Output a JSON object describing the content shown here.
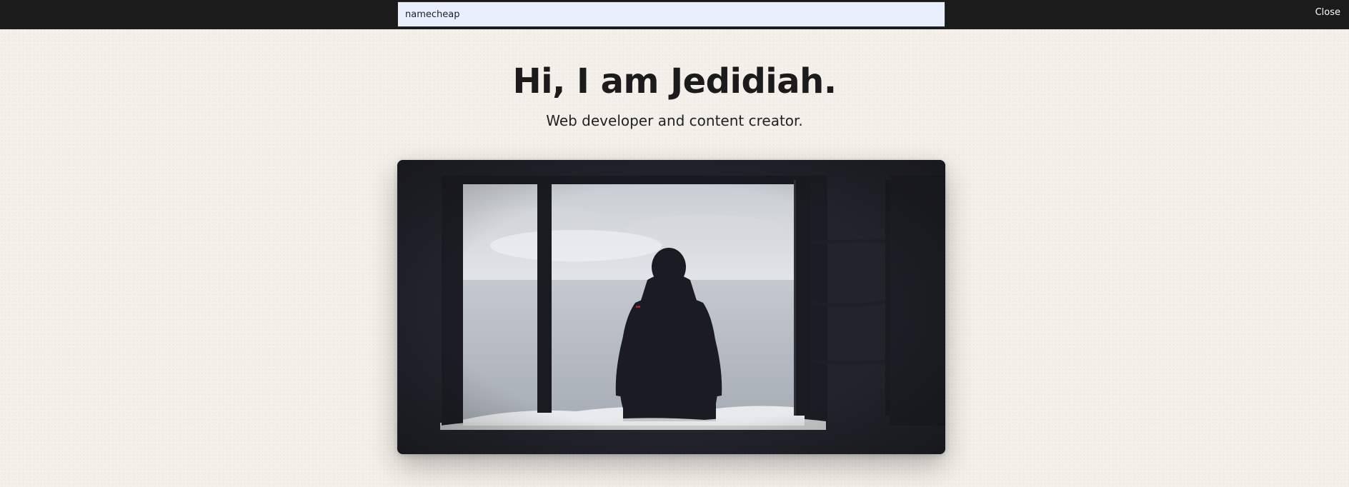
{
  "search": {
    "value": "namecheap",
    "placeholder": ""
  },
  "topbar": {
    "close_label": "Close"
  },
  "hero": {
    "title": "Hi, I am Jedidiah.",
    "subtitle": "Web developer and content creator."
  },
  "colors": {
    "page_background": "#f5f1ea",
    "topbar_background": "#1b1b1b",
    "search_background": "#e8f0fe",
    "text_primary": "#1b1b1b",
    "image_frame": "#22232b"
  }
}
